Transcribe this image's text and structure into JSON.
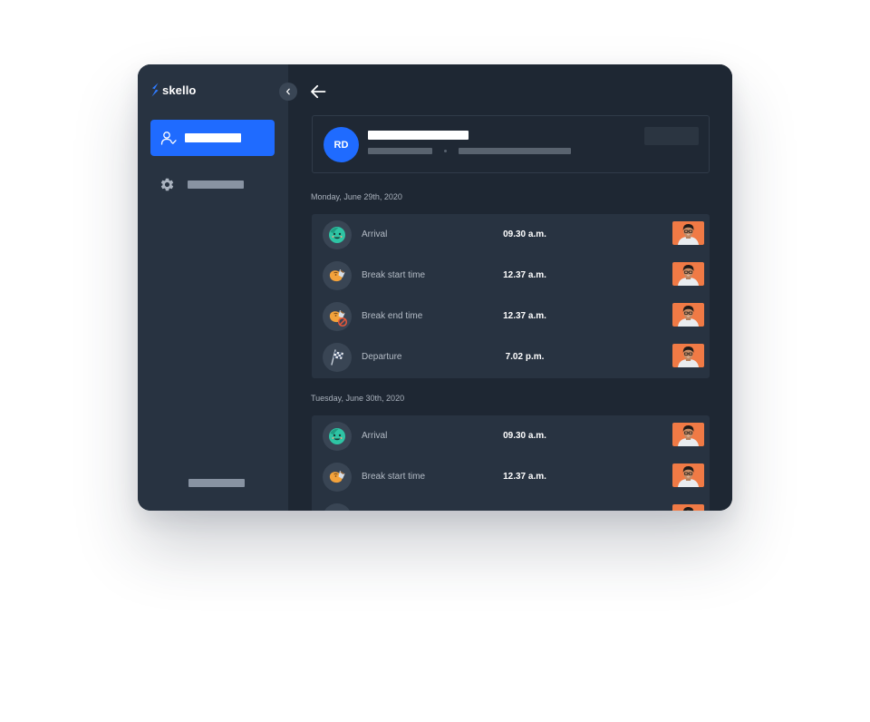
{
  "app": {
    "name": "skello"
  },
  "profile": {
    "initials": "RD"
  },
  "days": [
    {
      "date": "Monday, June 29th, 2020",
      "events": [
        {
          "icon": "arrival-face-icon",
          "label": "Arrival",
          "time": "09.30 a.m."
        },
        {
          "icon": "break-start-coffee-icon",
          "label": "Break start time",
          "time": "12.37 a.m."
        },
        {
          "icon": "break-end-coffee-icon",
          "label": "Break end time",
          "time": "12.37 a.m."
        },
        {
          "icon": "checkered-flag-icon",
          "label": "Departure",
          "time": "7.02 p.m."
        }
      ]
    },
    {
      "date": "Tuesday, June 30th, 2020",
      "events": [
        {
          "icon": "arrival-face-icon",
          "label": "Arrival",
          "time": "09.30 a.m."
        },
        {
          "icon": "break-start-coffee-icon",
          "label": "Break start time",
          "time": "12.37 a.m."
        },
        {
          "icon": "break-end-coffee-icon",
          "label": "",
          "time": ""
        }
      ]
    }
  ],
  "colors": {
    "accent": "#1f6bff",
    "sidebar": "#283341",
    "background": "#1e2733",
    "photo_bg": "#f07a45"
  }
}
